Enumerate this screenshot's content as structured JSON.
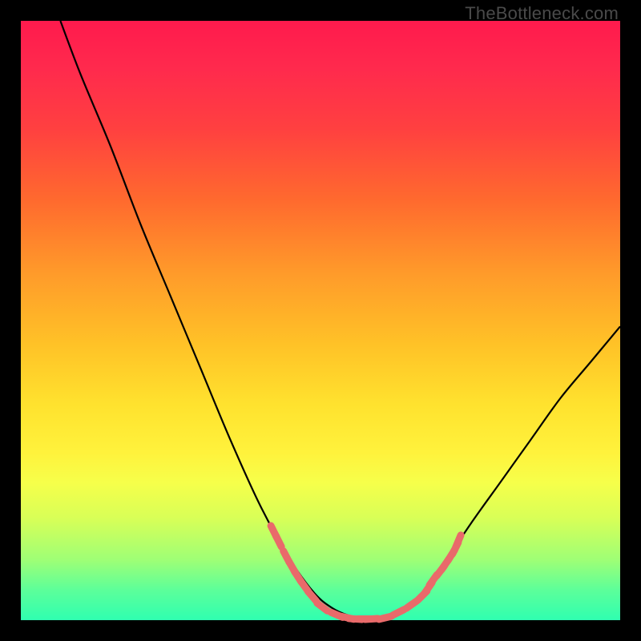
{
  "watermark": "TheBottleneck.com",
  "chart_data": {
    "type": "line",
    "title": "",
    "xlabel": "",
    "ylabel": "",
    "xlim": [
      0,
      100
    ],
    "ylim": [
      0,
      100
    ],
    "grid": false,
    "legend": false,
    "background_gradient": {
      "top": "#ff1a4d",
      "mid": "#ffe22e",
      "bottom": "#2fffb0"
    },
    "series": [
      {
        "name": "bottleneck-curve",
        "color": "#000000",
        "x": [
          6.6,
          10,
          15,
          20,
          25,
          30,
          35,
          40,
          45,
          49,
          52,
          55,
          58.5,
          61,
          63,
          65,
          67,
          70,
          75,
          80,
          85,
          90,
          95,
          100
        ],
        "y": [
          100,
          91,
          79,
          66,
          54,
          42,
          30,
          19,
          10,
          4.5,
          2,
          0.7,
          0.2,
          0.5,
          1.2,
          2.5,
          4.3,
          8.5,
          16,
          23,
          30,
          37,
          43,
          49
        ]
      },
      {
        "name": "highlight-dashes",
        "color": "#e96a6a",
        "style": "dashed-segments",
        "points": [
          {
            "x": 42.2,
            "y": 14.8
          },
          {
            "x": 43.0,
            "y": 13.2
          },
          {
            "x": 44.3,
            "y": 10.6
          },
          {
            "x": 45.3,
            "y": 8.8
          },
          {
            "x": 46.2,
            "y": 7.3
          },
          {
            "x": 47.3,
            "y": 5.7
          },
          {
            "x": 48.6,
            "y": 4.0
          },
          {
            "x": 50.3,
            "y": 2.2
          },
          {
            "x": 52.7,
            "y": 0.9
          },
          {
            "x": 54.5,
            "y": 0.4
          },
          {
            "x": 55.8,
            "y": 0.2
          },
          {
            "x": 57.3,
            "y": 0.2
          },
          {
            "x": 58.5,
            "y": 0.2
          },
          {
            "x": 60.8,
            "y": 0.4
          },
          {
            "x": 63.0,
            "y": 1.3
          },
          {
            "x": 65.2,
            "y": 2.6
          },
          {
            "x": 67.0,
            "y": 4.1
          },
          {
            "x": 68.0,
            "y": 5.4
          },
          {
            "x": 68.8,
            "y": 6.7
          },
          {
            "x": 70.0,
            "y": 8.2
          },
          {
            "x": 70.8,
            "y": 9.3
          },
          {
            "x": 71.8,
            "y": 10.8
          },
          {
            "x": 72.5,
            "y": 12.0
          },
          {
            "x": 73.0,
            "y": 13.2
          }
        ]
      }
    ]
  }
}
